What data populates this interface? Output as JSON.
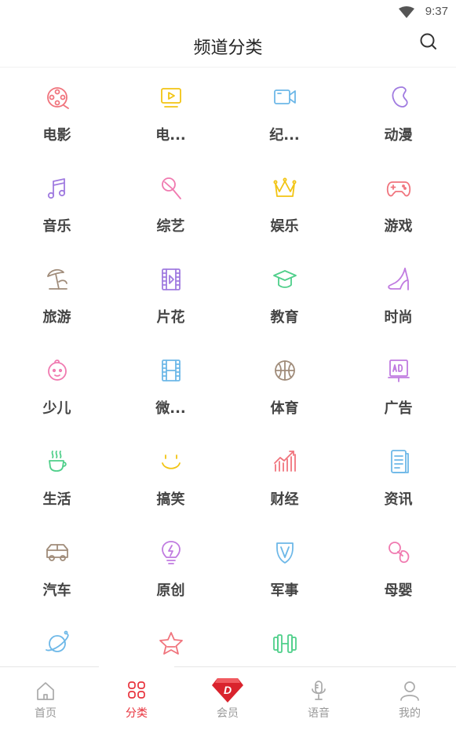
{
  "status_bar": {
    "time": "9:37"
  },
  "header": {
    "title": "频道分类"
  },
  "channels": [
    {
      "label": "电影",
      "icon": "film-reel-icon",
      "color": "#f0747d"
    },
    {
      "label": "电...",
      "icon": "tv-play-icon",
      "color": "#f2c413"
    },
    {
      "label": "纪...",
      "icon": "video-camera-icon",
      "color": "#6db8e8"
    },
    {
      "label": "动漫",
      "icon": "bean-icon",
      "color": "#a07be0"
    },
    {
      "label": "音乐",
      "icon": "music-note-icon",
      "color": "#a07be0"
    },
    {
      "label": "综艺",
      "icon": "microphone-icon",
      "color": "#f07ab0"
    },
    {
      "label": "娱乐",
      "icon": "crown-icon",
      "color": "#f2c413"
    },
    {
      "label": "游戏",
      "icon": "gamepad-icon",
      "color": "#f0747d"
    },
    {
      "label": "旅游",
      "icon": "beach-umbrella-icon",
      "color": "#a08c7a"
    },
    {
      "label": "片花",
      "icon": "film-clip-icon",
      "color": "#a07be0"
    },
    {
      "label": "教育",
      "icon": "graduation-cap-icon",
      "color": "#4fcf8a"
    },
    {
      "label": "时尚",
      "icon": "high-heel-icon",
      "color": "#c07be0"
    },
    {
      "label": "少儿",
      "icon": "baby-face-icon",
      "color": "#f07ab0"
    },
    {
      "label": "微...",
      "icon": "film-strip-icon",
      "color": "#6db8e8"
    },
    {
      "label": "体育",
      "icon": "basketball-icon",
      "color": "#a08c7a"
    },
    {
      "label": "广告",
      "icon": "ad-board-icon",
      "color": "#c07be0"
    },
    {
      "label": "生活",
      "icon": "hot-cup-icon",
      "color": "#4fcf8a"
    },
    {
      "label": "搞笑",
      "icon": "smile-icon",
      "color": "#f2c413"
    },
    {
      "label": "财经",
      "icon": "chart-trend-icon",
      "color": "#f0747d"
    },
    {
      "label": "资讯",
      "icon": "news-document-icon",
      "color": "#6db8e8"
    },
    {
      "label": "汽车",
      "icon": "car-icon",
      "color": "#a08c7a"
    },
    {
      "label": "原创",
      "icon": "lightbulb-icon",
      "color": "#c07be0"
    },
    {
      "label": "军事",
      "icon": "military-badge-icon",
      "color": "#6db8e8"
    },
    {
      "label": "母婴",
      "icon": "pacifier-icon",
      "color": "#f07ab0"
    },
    {
      "label": "",
      "icon": "planet-icon",
      "color": "#6db8e8"
    },
    {
      "label": "",
      "icon": "star-icon",
      "color": "#f0747d"
    },
    {
      "label": "",
      "icon": "dumbbell-icon",
      "color": "#4fcf8a"
    }
  ],
  "tabs": [
    {
      "label": "首页",
      "icon": "home-icon",
      "active": false
    },
    {
      "label": "分类",
      "icon": "category-grid-icon",
      "active": true
    },
    {
      "label": "会员",
      "icon": "vip-diamond-icon",
      "active": false
    },
    {
      "label": "语音",
      "icon": "microphone-icon",
      "active": false
    },
    {
      "label": "我的",
      "icon": "user-icon",
      "active": false
    }
  ],
  "colors": {
    "accent": "#e8323c",
    "tab_inactive": "#999999",
    "vip_red": "#d9232d"
  }
}
